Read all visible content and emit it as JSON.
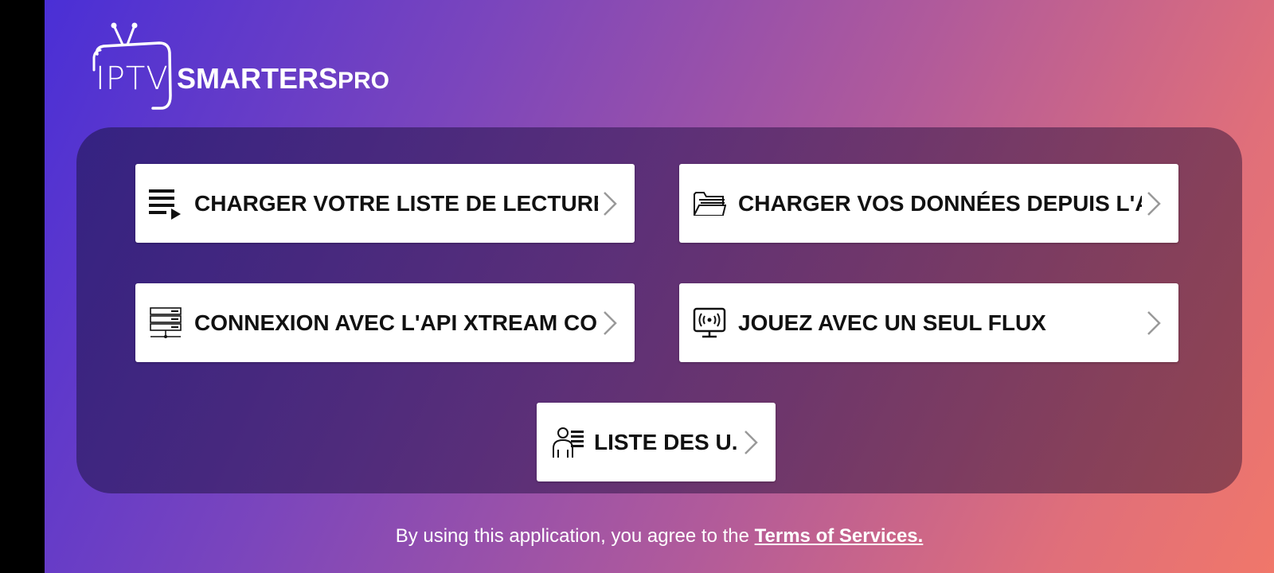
{
  "brand": {
    "logo_part1": "IPTV",
    "logo_part2": "SMARTERS",
    "logo_part3": "PRO"
  },
  "menu": {
    "items": [
      {
        "label": "CHARGER VOTRE LISTE DE LECTURE..",
        "icon": "playlist-icon"
      },
      {
        "label": "CHARGER VOS DONNÉES DEPUIS L'AP..",
        "icon": "folder-icon"
      },
      {
        "label": "CONNEXION AVEC L'API XTREAM COD..",
        "icon": "server-icon"
      },
      {
        "label": "JOUEZ AVEC UN SEUL FLUX",
        "icon": "stream-monitor-icon"
      },
      {
        "label": "LISTE DES U..",
        "icon": "user-list-icon"
      }
    ]
  },
  "footer": {
    "text": "By using this application, you agree to the ",
    "link": "Terms of Services."
  },
  "colors": {
    "gradient_start": "#4a2fd6",
    "gradient_end": "#f0776a",
    "card_bg": "#ffffff",
    "text_dark": "#111111"
  }
}
